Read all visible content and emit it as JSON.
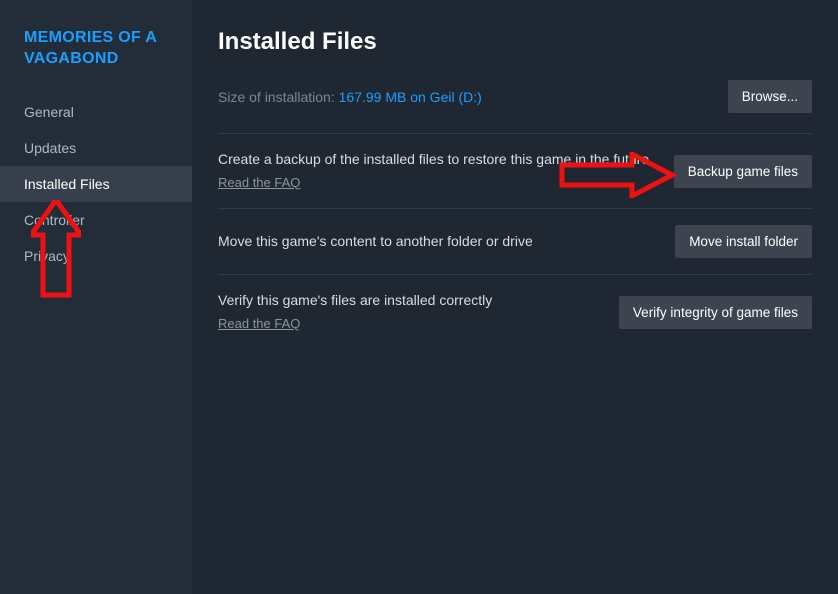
{
  "game_title": "MEMORIES OF A VAGABOND",
  "sidebar": {
    "items": [
      {
        "label": "General"
      },
      {
        "label": "Updates"
      },
      {
        "label": "Installed Files"
      },
      {
        "label": "Controller"
      },
      {
        "label": "Privacy"
      }
    ]
  },
  "main": {
    "page_title": "Installed Files",
    "size_label": "Size of installation: ",
    "size_value": "167.99 MB on Geil (D:)",
    "browse_button": "Browse...",
    "backup": {
      "text": "Create a backup of the installed files to restore this game in the future",
      "faq": "Read the FAQ",
      "button": "Backup game files"
    },
    "move": {
      "text": "Move this game's content to another folder or drive",
      "button": "Move install folder"
    },
    "verify": {
      "text": "Verify this game's files are installed correctly",
      "faq": "Read the FAQ",
      "button": "Verify integrity of game files"
    }
  }
}
